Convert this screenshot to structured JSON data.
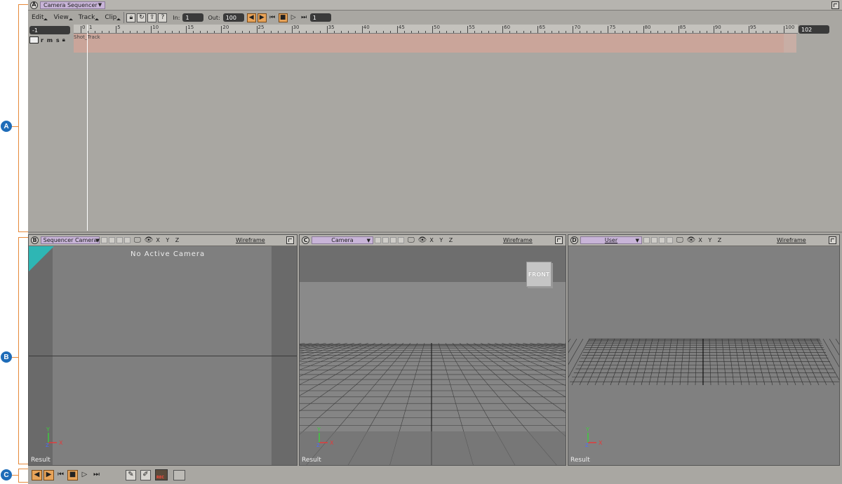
{
  "callouts": [
    "A",
    "B",
    "C"
  ],
  "sequencer": {
    "panel_letter": "A",
    "title": "Camera Sequencer",
    "menus": [
      "Edit",
      "View",
      "Track",
      "Clip"
    ],
    "in_label": "In:",
    "in_value": "1",
    "out_label": "Out:",
    "out_value": "100",
    "frame_value": "1",
    "ruler_start": "-1",
    "ruler_end": "102",
    "ruler_ticks": [
      "0",
      "1",
      "5",
      "10",
      "15",
      "20",
      "25",
      "30",
      "35",
      "40",
      "45",
      "50",
      "55",
      "60",
      "65",
      "70",
      "75",
      "80",
      "85",
      "90",
      "95",
      "100"
    ],
    "track_toggles": "r m s",
    "track_name": "Shot_Track",
    "track_color": "#e6a494"
  },
  "viewports": [
    {
      "letter": "B",
      "camera": "Sequencer Camera",
      "axes": "X Y Z",
      "shading": "Wireframe",
      "message": "No Active Camera",
      "result": "Result",
      "gizmo": {
        "y": "Y",
        "x": "X",
        "z": "Z"
      }
    },
    {
      "letter": "C",
      "camera": "Camera",
      "axes": "X Y Z",
      "shading": "Wireframe",
      "cube_label": "FRONT",
      "result": "Result",
      "gizmo": {
        "y": "Y",
        "x": "X",
        "z": "Z"
      }
    },
    {
      "letter": "D",
      "camera": "User",
      "axes": "X Y Z",
      "shading": "Wireframe",
      "result": "Result",
      "gizmo": {
        "y": "Y",
        "x": "X",
        "z": "Z"
      }
    }
  ],
  "transport": {
    "record_label": "REC"
  },
  "colors": {
    "accent_orange": "#e8a45a",
    "title_lilac": "#c8b4d8",
    "callout_blue": "#1e6cb8",
    "bracket_orange": "#e6893a"
  }
}
